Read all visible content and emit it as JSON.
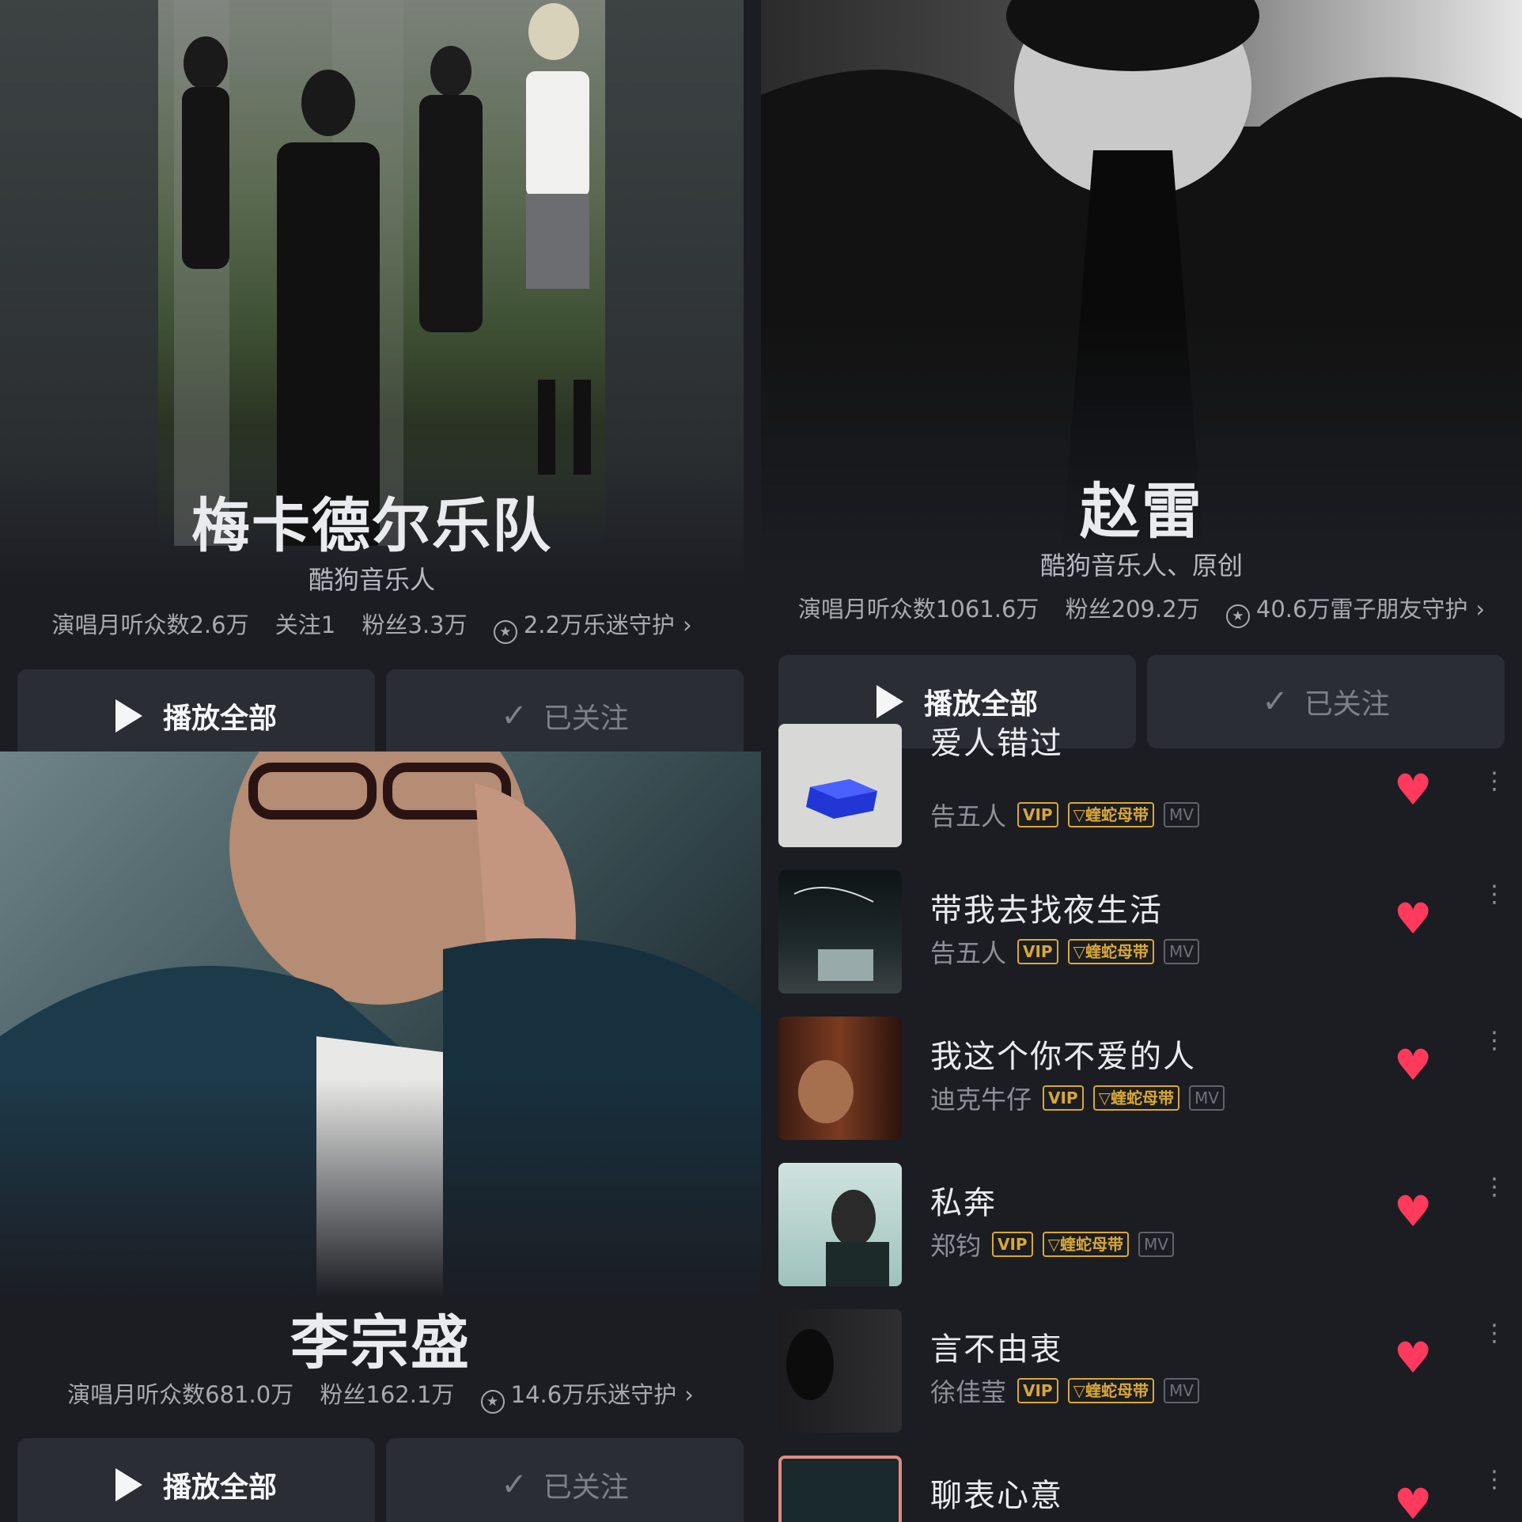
{
  "panel_meikader": {
    "artist_name": "梅卡德尔乐队",
    "subtitle": "酷狗音乐人",
    "stat_listeners": "演唱月听众数2.6万",
    "stat_following": "关注1",
    "stat_fans": "粉丝3.3万",
    "stat_guard": "2.2万乐迷守护",
    "play_all": "播放全部",
    "follow": "已关注"
  },
  "panel_zhaolei": {
    "artist_name": "赵雷",
    "subtitle": "酷狗音乐人、原创",
    "stat_listeners": "演唱月听众数1061.6万",
    "stat_fans": "粉丝209.2万",
    "stat_guard": "40.6万雷子朋友守护",
    "play_all": "播放全部",
    "follow": "已关注"
  },
  "panel_lizongsheng": {
    "artist_name": "李宗盛",
    "stat_listeners": "演唱月听众数681.0万",
    "stat_fans": "粉丝162.1万",
    "stat_guard": "14.6万乐迷守护",
    "play_all": "播放全部",
    "follow": "已关注"
  },
  "songs": [
    {
      "title": "爱人错过",
      "artist": "告五人",
      "tags": [
        "VIP",
        "蝰蛇母带",
        "MV"
      ]
    },
    {
      "title": "带我去找夜生活",
      "artist": "告五人",
      "tags": [
        "VIP",
        "蝰蛇母带",
        "MV"
      ]
    },
    {
      "title": "我这个你不爱的人",
      "artist": "迪克牛仔",
      "tags": [
        "VIP",
        "蝰蛇母带",
        "MV"
      ]
    },
    {
      "title": "私奔",
      "artist": "郑钧",
      "tags": [
        "VIP",
        "蝰蛇母带",
        "MV"
      ]
    },
    {
      "title": "言不由衷",
      "artist": "徐佳莹",
      "tags": [
        "VIP",
        "蝰蛇母带",
        "MV"
      ]
    },
    {
      "title": "聊表心意",
      "artist": "",
      "tags": []
    }
  ],
  "icons": {
    "play": "play-icon",
    "check": "check-icon",
    "guard": "guard-star-icon",
    "chevron": "chevron-right-icon",
    "heart": "heart-icon",
    "more": "more-vertical-icon"
  },
  "colors": {
    "background": "#1b1d23",
    "button": "#2a2d34",
    "heart": "#ff3a5c",
    "tag_gold": "#d9a836"
  }
}
